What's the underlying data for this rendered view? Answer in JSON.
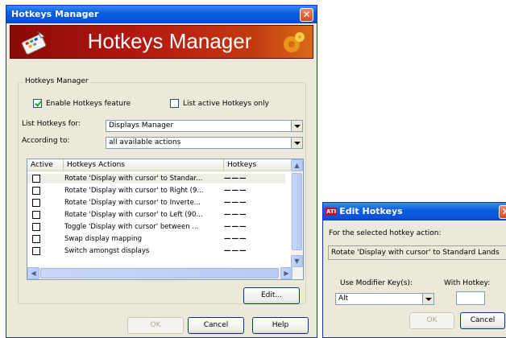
{
  "hotkeys_window": {
    "title": "Hotkeys Manager",
    "banner_title": "Hotkeys Manager",
    "group_label": "Hotkeys Manager",
    "enable_feature": {
      "label": "Enable Hotkeys feature",
      "checked": true
    },
    "list_active_only": {
      "label": "List active Hotkeys only",
      "checked": false
    },
    "list_for": {
      "label": "List Hotkeys for:",
      "value": "Displays Manager"
    },
    "according_to": {
      "label": "According to:",
      "value": "all available actions"
    },
    "table": {
      "columns": [
        "Active",
        "Hotkeys Actions",
        "Hotkeys"
      ],
      "rows": [
        {
          "action": "Rotate 'Display with cursor' to Standar...",
          "hotkey": "———",
          "active": false
        },
        {
          "action": "Rotate 'Display with cursor' to Right (9...",
          "hotkey": "———",
          "active": false
        },
        {
          "action": "Rotate 'Display with cursor' to Inverte...",
          "hotkey": "———",
          "active": false
        },
        {
          "action": "Rotate 'Display with cursor' to Left (90...",
          "hotkey": "———",
          "active": false
        },
        {
          "action": "Toggle 'Display with cursor' between ...",
          "hotkey": "———",
          "active": false
        },
        {
          "action": "Swap display mapping",
          "hotkey": "———",
          "active": false
        },
        {
          "action": "Switch amongst displays",
          "hotkey": "———",
          "active": false
        }
      ]
    },
    "edit_button": "Edit...",
    "ok_button": "OK",
    "cancel_button": "Cancel",
    "help_button": "Help"
  },
  "edit_window": {
    "title": "Edit Hotkeys",
    "logo_text": "ATI",
    "prompt": "For the selected hotkey action:",
    "action_text": "Rotate 'Display with cursor' to Standard Lands",
    "modifier_label": "Use Modifier Key(s):",
    "modifier_value": "Alt",
    "hotkey_label": "With Hotkey:",
    "hotkey_value": "",
    "ok_button": "OK",
    "cancel_button": "Cancel"
  },
  "colors": {
    "titlebar": "#0a5fe0",
    "dialog_bg": "#ece9d8",
    "banner": "#b51a10"
  }
}
